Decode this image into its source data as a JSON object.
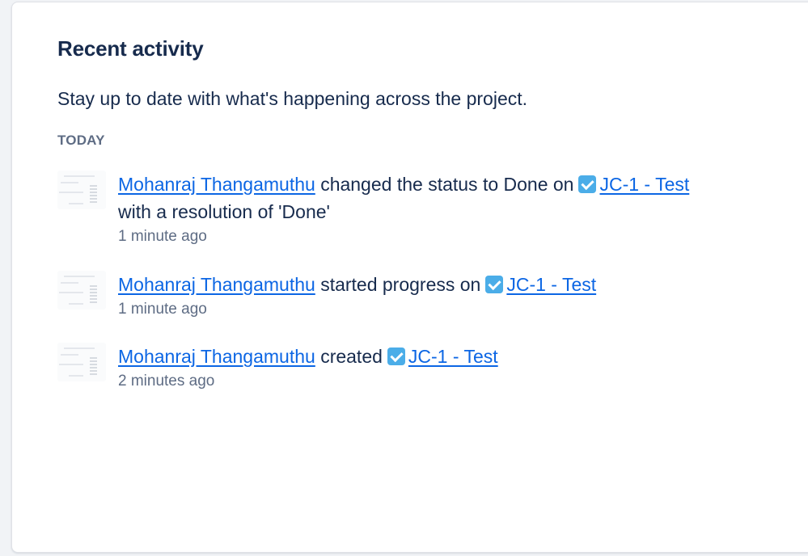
{
  "panel": {
    "title": "Recent activity",
    "subtitle": "Stay up to date with what's happening across the project.",
    "day_header": "TODAY"
  },
  "activities": [
    {
      "user": "Mohanraj Thangamuthu",
      "action": "changed the status to Done on",
      "issue": "JC-1 - Test",
      "continuation": "with a resolution of 'Done'",
      "time": "1 minute ago",
      "issue_icon": "task-check-icon"
    },
    {
      "user": "Mohanraj Thangamuthu",
      "action": "started progress on",
      "issue": "JC-1 - Test",
      "time": "1 minute ago",
      "issue_icon": "task-check-icon"
    },
    {
      "user": "Mohanraj Thangamuthu",
      "action": "created",
      "issue": "JC-1 - Test",
      "time": "2 minutes ago",
      "issue_icon": "task-check-icon"
    }
  ],
  "colors": {
    "link": "#0c66e4",
    "task_icon": "#4bade8",
    "muted_text": "#5e6c84",
    "primary_text": "#172b4d"
  }
}
